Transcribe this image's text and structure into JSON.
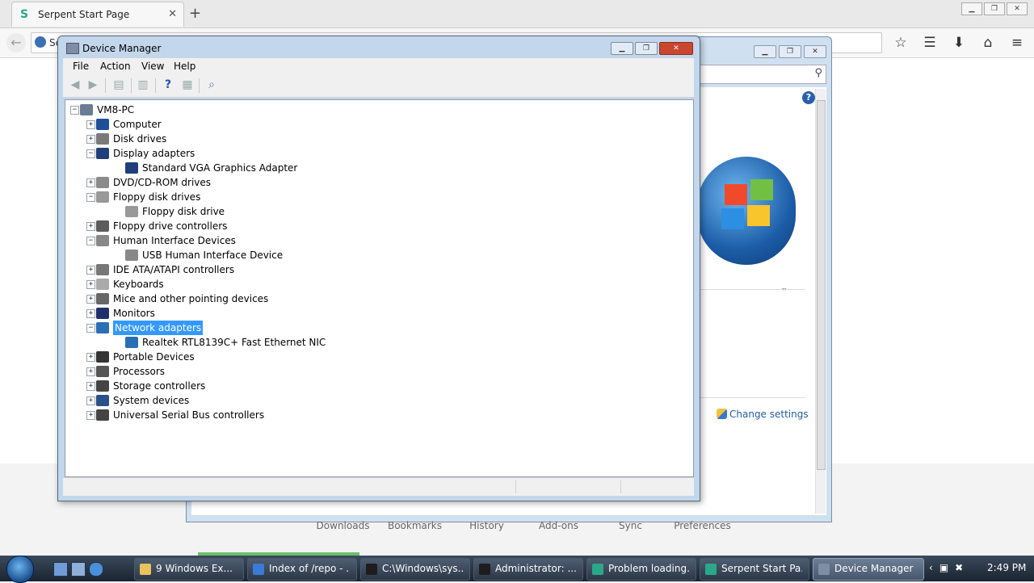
{
  "browser": {
    "tab_title": "Serpent Start Page",
    "url_text": "Se",
    "footer_links": [
      "Downloads",
      "Bookmarks",
      "History",
      "Add-ons",
      "Sync",
      "Preferences"
    ]
  },
  "bg_window": {
    "link_change_settings": "Change settings",
    "trademark": "™"
  },
  "device_manager": {
    "title": "Device Manager",
    "menu": [
      "File",
      "Action",
      "View",
      "Help"
    ],
    "tree": [
      {
        "label": "VM8-PC",
        "level": 0,
        "expander": "-",
        "icon": "computer-root-icon"
      },
      {
        "label": "Computer",
        "level": 1,
        "expander": "+",
        "icon": "computer-icon"
      },
      {
        "label": "Disk drives",
        "level": 1,
        "expander": "+",
        "icon": "disk-drive-icon"
      },
      {
        "label": "Display adapters",
        "level": 1,
        "expander": "-",
        "icon": "display-adapter-icon"
      },
      {
        "label": "Standard VGA Graphics Adapter",
        "level": 2,
        "expander": "",
        "icon": "display-adapter-icon"
      },
      {
        "label": "DVD/CD-ROM drives",
        "level": 1,
        "expander": "+",
        "icon": "dvd-drive-icon"
      },
      {
        "label": "Floppy disk drives",
        "level": 1,
        "expander": "-",
        "icon": "floppy-drive-icon"
      },
      {
        "label": "Floppy disk drive",
        "level": 2,
        "expander": "",
        "icon": "floppy-drive-icon"
      },
      {
        "label": "Floppy drive controllers",
        "level": 1,
        "expander": "+",
        "icon": "floppy-controller-icon"
      },
      {
        "label": "Human Interface Devices",
        "level": 1,
        "expander": "-",
        "icon": "hid-icon"
      },
      {
        "label": "USB Human Interface Device",
        "level": 2,
        "expander": "",
        "icon": "hid-icon"
      },
      {
        "label": "IDE ATA/ATAPI controllers",
        "level": 1,
        "expander": "+",
        "icon": "ide-controller-icon"
      },
      {
        "label": "Keyboards",
        "level": 1,
        "expander": "+",
        "icon": "keyboard-icon"
      },
      {
        "label": "Mice and other pointing devices",
        "level": 1,
        "expander": "+",
        "icon": "mouse-icon"
      },
      {
        "label": "Monitors",
        "level": 1,
        "expander": "+",
        "icon": "monitor-icon"
      },
      {
        "label": "Network adapters",
        "level": 1,
        "expander": "-",
        "icon": "network-adapter-icon",
        "selected": true
      },
      {
        "label": "Realtek RTL8139C+ Fast Ethernet NIC",
        "level": 2,
        "expander": "",
        "icon": "network-adapter-icon"
      },
      {
        "label": "Portable Devices",
        "level": 1,
        "expander": "+",
        "icon": "portable-device-icon"
      },
      {
        "label": "Processors",
        "level": 1,
        "expander": "+",
        "icon": "processor-icon"
      },
      {
        "label": "Storage controllers",
        "level": 1,
        "expander": "+",
        "icon": "storage-controller-icon"
      },
      {
        "label": "System devices",
        "level": 1,
        "expander": "+",
        "icon": "system-device-icon"
      },
      {
        "label": "Universal Serial Bus controllers",
        "level": 1,
        "expander": "+",
        "icon": "usb-icon"
      }
    ]
  },
  "taskbar": {
    "items": [
      {
        "label": "9 Windows Ex...",
        "icon_color": "#e8c25a",
        "active": false
      },
      {
        "label": "Index of /repo - ...",
        "icon_color": "#3a7bd5",
        "active": false
      },
      {
        "label": "C:\\Windows\\sys...",
        "icon_color": "#1d1d1d",
        "active": false
      },
      {
        "label": "Administrator: ...",
        "icon_color": "#1d1d1d",
        "active": false
      },
      {
        "label": "Problem loading...",
        "icon_color": "#2aa889",
        "active": false
      },
      {
        "label": "Serpent Start Pa...",
        "icon_color": "#2aa889",
        "active": false
      },
      {
        "label": "Device Manager",
        "icon_color": "#7d8fa5",
        "active": true
      }
    ],
    "clock": "2:49 PM"
  }
}
